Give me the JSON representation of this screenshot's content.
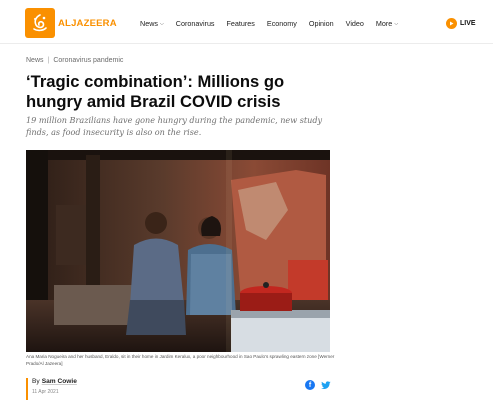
{
  "header": {
    "logo_text": "ALJAZEERA",
    "nav": [
      {
        "label": "News",
        "has_dropdown": true
      },
      {
        "label": "Coronavirus",
        "has_dropdown": false
      },
      {
        "label": "Features",
        "has_dropdown": false
      },
      {
        "label": "Economy",
        "has_dropdown": false
      },
      {
        "label": "Opinion",
        "has_dropdown": false
      },
      {
        "label": "Video",
        "has_dropdown": false
      },
      {
        "label": "More",
        "has_dropdown": true
      }
    ],
    "live_label": "LIVE"
  },
  "breadcrumb": {
    "items": [
      "News",
      "Coronavirus pandemic"
    ]
  },
  "article": {
    "title": "‘Tragic combination’: Millions go hungry amid Brazil COVID crisis",
    "summary": "19 million Brazilians have gone hungry during the pandemic, new study finds, as food insecurity is also on the rise.",
    "caption": "Ana Maria Nogueira and her husband, Eraldo, sit in their home in Jardim Keralux, a poor neighbourhood in Sao Paulo’s sprawling eastern zone [Werner Prado/Al Jazeera]",
    "by_prefix": "By",
    "author": "Sam Cowie",
    "date": "11 Apr 2021"
  },
  "colors": {
    "brand": "#fa9000",
    "facebook": "#1877f2",
    "twitter": "#1da1f2"
  },
  "icons": {
    "logo": "aljazeera-calligraphy-logo",
    "live": "play-icon",
    "facebook": "facebook-icon",
    "twitter": "twitter-icon"
  }
}
